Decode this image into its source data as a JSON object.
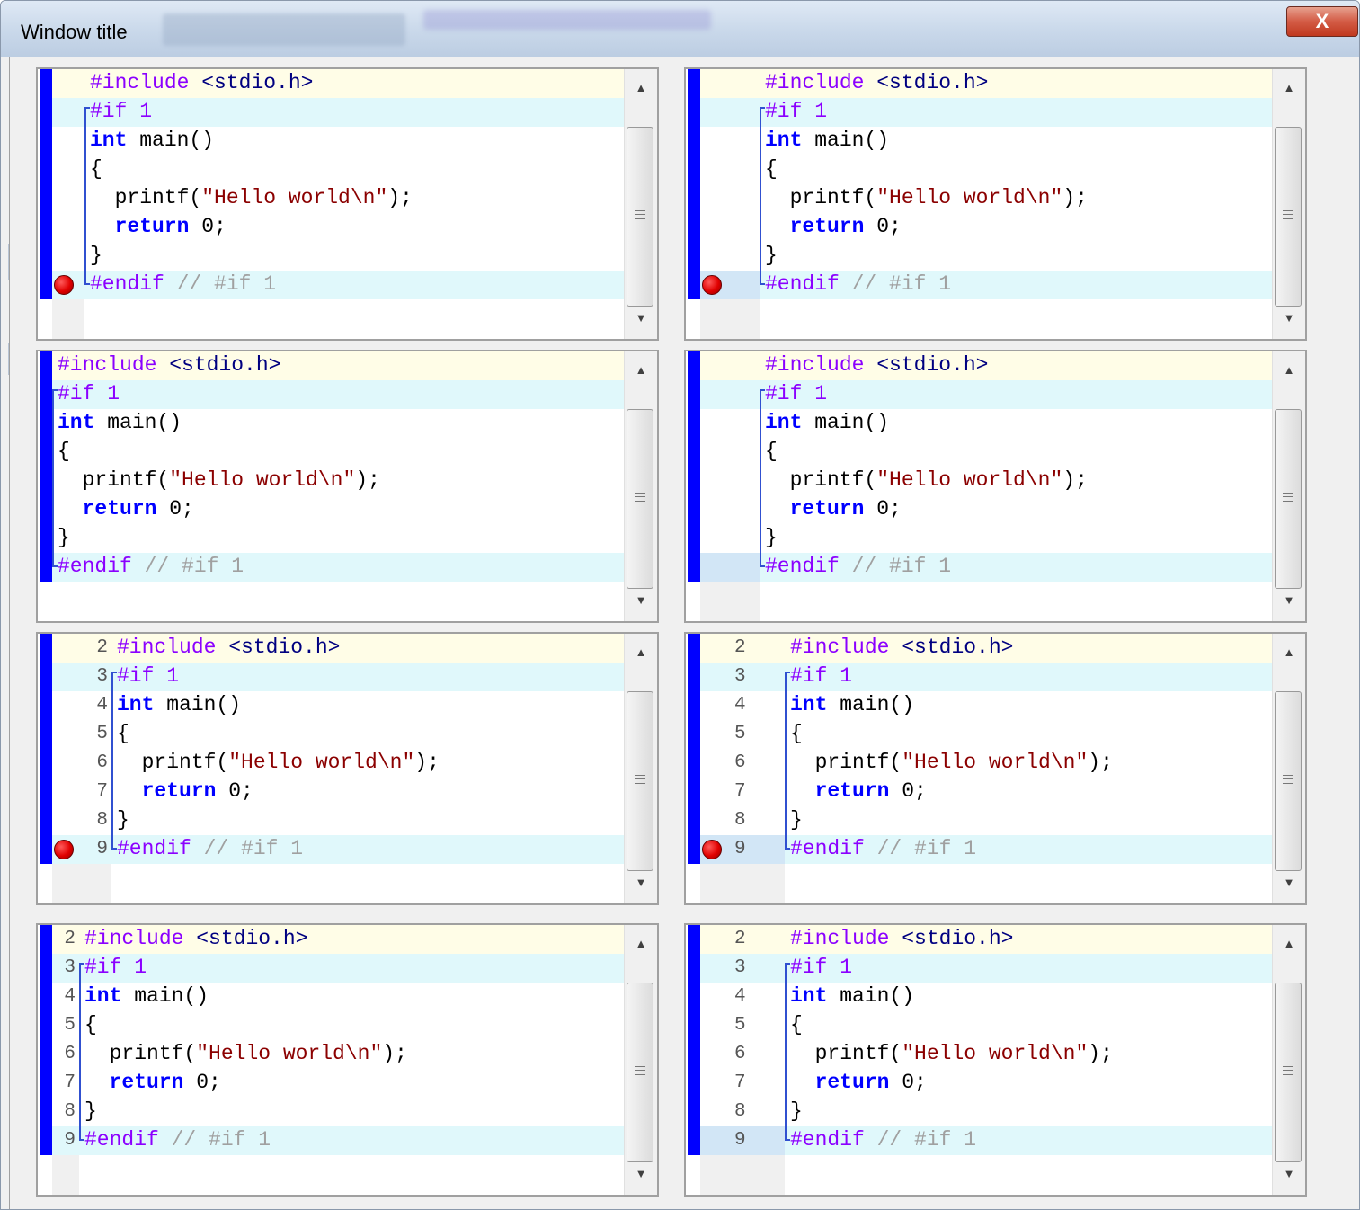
{
  "window": {
    "title": "Window title",
    "close_label": "X"
  },
  "code": {
    "line_numbers": [
      "2",
      "3",
      "4",
      "5",
      "6",
      "7",
      "8",
      "9"
    ],
    "lines": [
      {
        "number": "2",
        "parts": [
          {
            "c": "pp",
            "t": "#include "
          },
          {
            "c": "inc",
            "t": "<stdio.h>"
          }
        ]
      },
      {
        "number": "3",
        "parts": [
          {
            "c": "pp",
            "t": "#if 1"
          }
        ]
      },
      {
        "number": "4",
        "parts": [
          {
            "c": "kw",
            "t": "int"
          },
          {
            "c": "",
            "t": " main()"
          }
        ]
      },
      {
        "number": "5",
        "parts": [
          {
            "c": "",
            "t": "{"
          }
        ]
      },
      {
        "number": "6",
        "parts": [
          {
            "c": "",
            "t": "  printf("
          },
          {
            "c": "str",
            "t": "\"Hello world\\n\""
          },
          {
            "c": "",
            "t": ");"
          }
        ]
      },
      {
        "number": "7",
        "parts": [
          {
            "c": "",
            "t": "  "
          },
          {
            "c": "kw",
            "t": "return"
          },
          {
            "c": "",
            "t": " 0;"
          }
        ]
      },
      {
        "number": "8",
        "parts": [
          {
            "c": "",
            "t": "}"
          }
        ]
      },
      {
        "number": "9",
        "parts": [
          {
            "c": "pp",
            "t": "#endif "
          },
          {
            "c": "cmt",
            "t": "// #if 1"
          }
        ]
      }
    ]
  },
  "editors": [
    {
      "id": "pane-1",
      "line_numbers": false,
      "breakpoint": true,
      "breakpoint_margin": "separate"
    },
    {
      "id": "pane-2",
      "line_numbers": false,
      "breakpoint": true,
      "breakpoint_margin": "wide"
    },
    {
      "id": "pane-3",
      "line_numbers": false,
      "breakpoint": false,
      "breakpoint_margin": "none"
    },
    {
      "id": "pane-4",
      "line_numbers": false,
      "breakpoint": false,
      "breakpoint_margin": "wide"
    },
    {
      "id": "pane-5",
      "line_numbers": true,
      "breakpoint": true,
      "breakpoint_margin": "separate"
    },
    {
      "id": "pane-6",
      "line_numbers": true,
      "breakpoint": true,
      "breakpoint_margin": "wide"
    },
    {
      "id": "pane-7",
      "line_numbers": true,
      "breakpoint": false,
      "breakpoint_margin": "none"
    },
    {
      "id": "pane-8",
      "line_numbers": true,
      "breakpoint": false,
      "breakpoint_margin": "wide"
    }
  ],
  "colors": {
    "selection_bar": "#0000ff",
    "include_line_bg": "#fffde7",
    "preprocessor_line_bg": "#e0f8fb",
    "breakpoint": "#e00000",
    "preprocessor": "#8b00ff",
    "keyword": "#0000ff",
    "string": "#8b0000",
    "comment": "#a0a0a0"
  },
  "icons": {
    "close": "close-icon",
    "breakpoint": "breakpoint-icon",
    "scroll_up": "scroll-up-arrow-icon",
    "scroll_down": "scroll-down-arrow-icon",
    "scroll_grip": "scroll-grip-icon"
  }
}
